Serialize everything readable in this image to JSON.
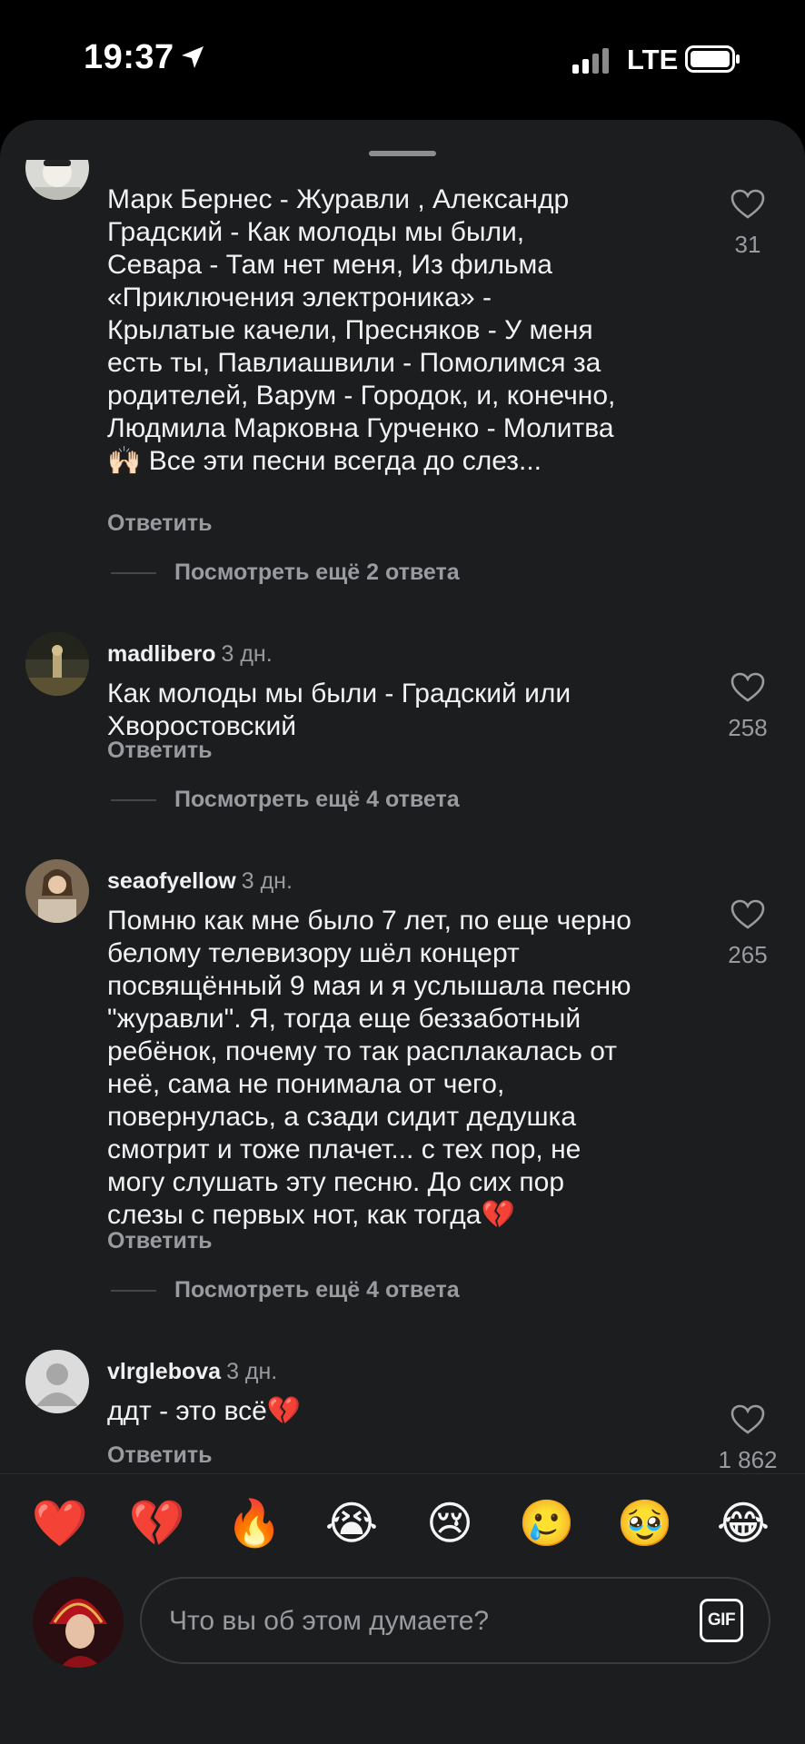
{
  "status_bar": {
    "time": "19:37",
    "network": "LTE"
  },
  "comments": [
    {
      "username": "",
      "ago": "",
      "text": "Марк Бернес - Журавли , Александр\nГрадский - Как молоды мы были,\nСевара - Там нет меня, Из фильма\n«Приключения электроника» -\nКрылатые качели, Пресняков - У меня\nесть ты, Павлиашвили - Помолимся за\nродителей, Варум - Городок, и, конечно,\nЛюдмила Марковна Гурченко - Молитва\n🙌🏻 Все эти песни всегда до слез...",
      "likes": "31",
      "reply_label": "Ответить",
      "more_replies": "Посмотреть ещё 2 ответа"
    },
    {
      "username": "madlibero",
      "ago": "3 дн.",
      "text": "Как молоды мы были - Градский или\nХворостовский",
      "likes": "258",
      "reply_label": "Ответить",
      "more_replies": "Посмотреть ещё 4 ответа"
    },
    {
      "username": "seaofyellow",
      "ago": "3 дн.",
      "text": "Помню как мне было 7 лет, по еще черно\nбелому телевизору шёл концерт\nпосвящённый 9 мая и я услышала песню\n\"журавли\". Я, тогда еще беззаботный\nребёнок, почему то так расплакалась от\nнеё, сама не понимала от чего,\nповернулась, а сзади сидит дедушка\nсмотрит и тоже плачет... с тех пор, не\nмогу слушать эту песню. До сих пор\nслезы с первых нот, как тогда💔",
      "likes": "265",
      "reply_label": "Ответить",
      "more_replies": "Посмотреть ещё 4 ответа"
    },
    {
      "username": "vlrglebova",
      "ago": "3 дн.",
      "text": "ддт - это всё💔",
      "likes": "1 862",
      "reply_label": "Ответить",
      "more_replies": ""
    }
  ],
  "emoji_bar": [
    "❤️",
    "💔",
    "🔥",
    "😭",
    "😢",
    "🥲",
    "🥹",
    "😂"
  ],
  "composer": {
    "placeholder": "Что вы об этом думаете?",
    "gif_label": "GIF"
  },
  "colors": {
    "sheet_bg": "#1c1d1f",
    "muted": "#9a9ba0",
    "text": "#f2f2f2"
  }
}
